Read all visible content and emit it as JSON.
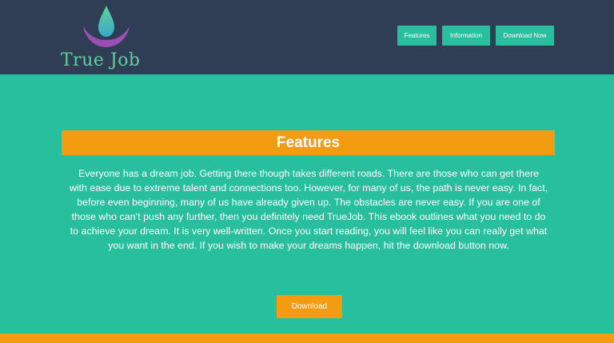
{
  "brand": {
    "name": "True Job",
    "logo_icon": "lotus-drop-icon",
    "colors": {
      "header": "#2f3e55",
      "accent_green": "#28bf9e",
      "accent_orange": "#f39c12",
      "logo_purple": "#9b4fb5",
      "logo_teal": "#4fc0b0"
    }
  },
  "nav": {
    "features": "Features",
    "information": "Information",
    "download_now": "Download Now"
  },
  "features": {
    "title": "Features",
    "body": "Everyone has a dream job. Getting there though takes different roads. There are those who can get there with ease due to extreme talent and connections too. However, for many of us, the path is never easy. In fact, before even beginning, many of us have already given up. The obstacles are never easy. If you are one of those who can’t push any further, then you definitely need TrueJob. This ebook outlines what you need to do to achieve your dream. It is very well-written. Once you start reading, you will feel like you can really get what you want in the end. If you wish to make your dreams happen, hit the download button now.",
    "download_label": "Download"
  }
}
